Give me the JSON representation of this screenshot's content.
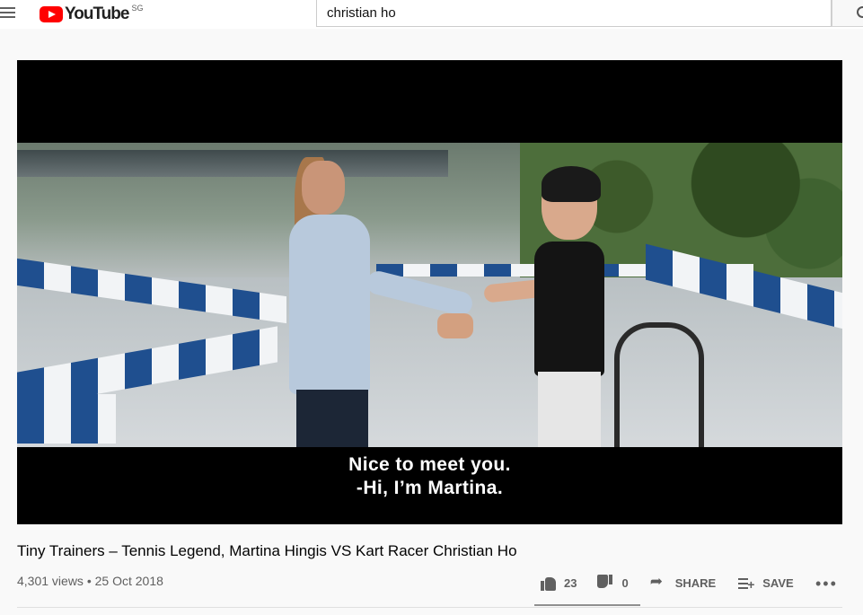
{
  "header": {
    "logo_text": "YouTube",
    "region": "SG",
    "search_query": "christian ho"
  },
  "player": {
    "subtitle_line1": "Nice to meet you.",
    "subtitle_line2": "-Hi, I’m Martina."
  },
  "video": {
    "title": "Tiny Trainers – Tennis Legend, Martina Hingis VS Kart Racer Christian Ho",
    "views": "4,301 views",
    "date": "25 Oct 2018",
    "likes": "23",
    "dislikes": "0",
    "share_label": "SHARE",
    "save_label": "SAVE",
    "more_label": "•••"
  },
  "colors": {
    "brand": "#ff0000",
    "text_secondary": "#606060"
  }
}
